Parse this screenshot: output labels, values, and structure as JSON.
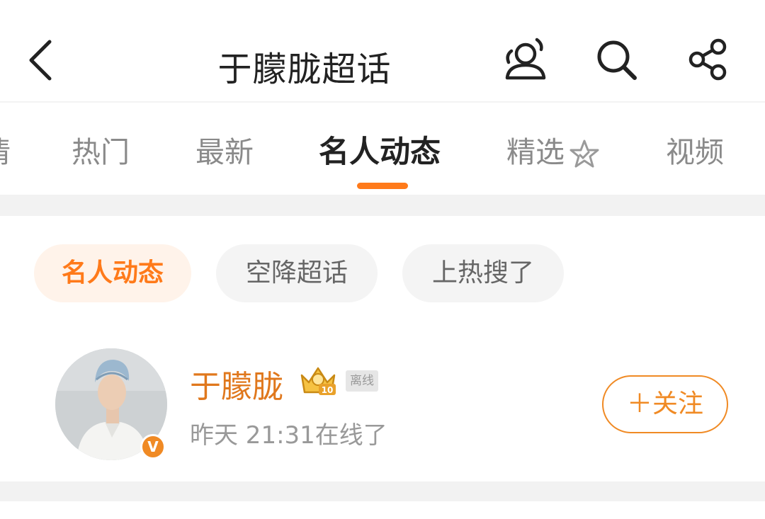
{
  "header": {
    "title": "于朦胧超话",
    "icons": [
      "back-chevron-icon",
      "users-sound-icon",
      "search-icon",
      "share-icon"
    ]
  },
  "tabs": [
    {
      "label": "情"
    },
    {
      "label": "热门"
    },
    {
      "label": "最新"
    },
    {
      "label": "名人动态",
      "active": true
    },
    {
      "label": "精选",
      "badge": "star-badge-icon"
    },
    {
      "label": "视频"
    }
  ],
  "chips": [
    {
      "label": "名人动态",
      "active": true
    },
    {
      "label": "空降超话"
    },
    {
      "label": "上热搜了"
    }
  ],
  "user": {
    "name": "于朦胧",
    "level": "10",
    "status_tag": "离线",
    "last_online": "昨天 21:31在线了",
    "verified_badge": "V"
  },
  "follow_button": "＋关注",
  "colors": {
    "accent": "#ff7a1a",
    "username": "#e0781d",
    "follow": "#f08a24",
    "text_primary": "#222222",
    "text_secondary": "#8a8a8a",
    "separator": "#f2f2f2"
  }
}
